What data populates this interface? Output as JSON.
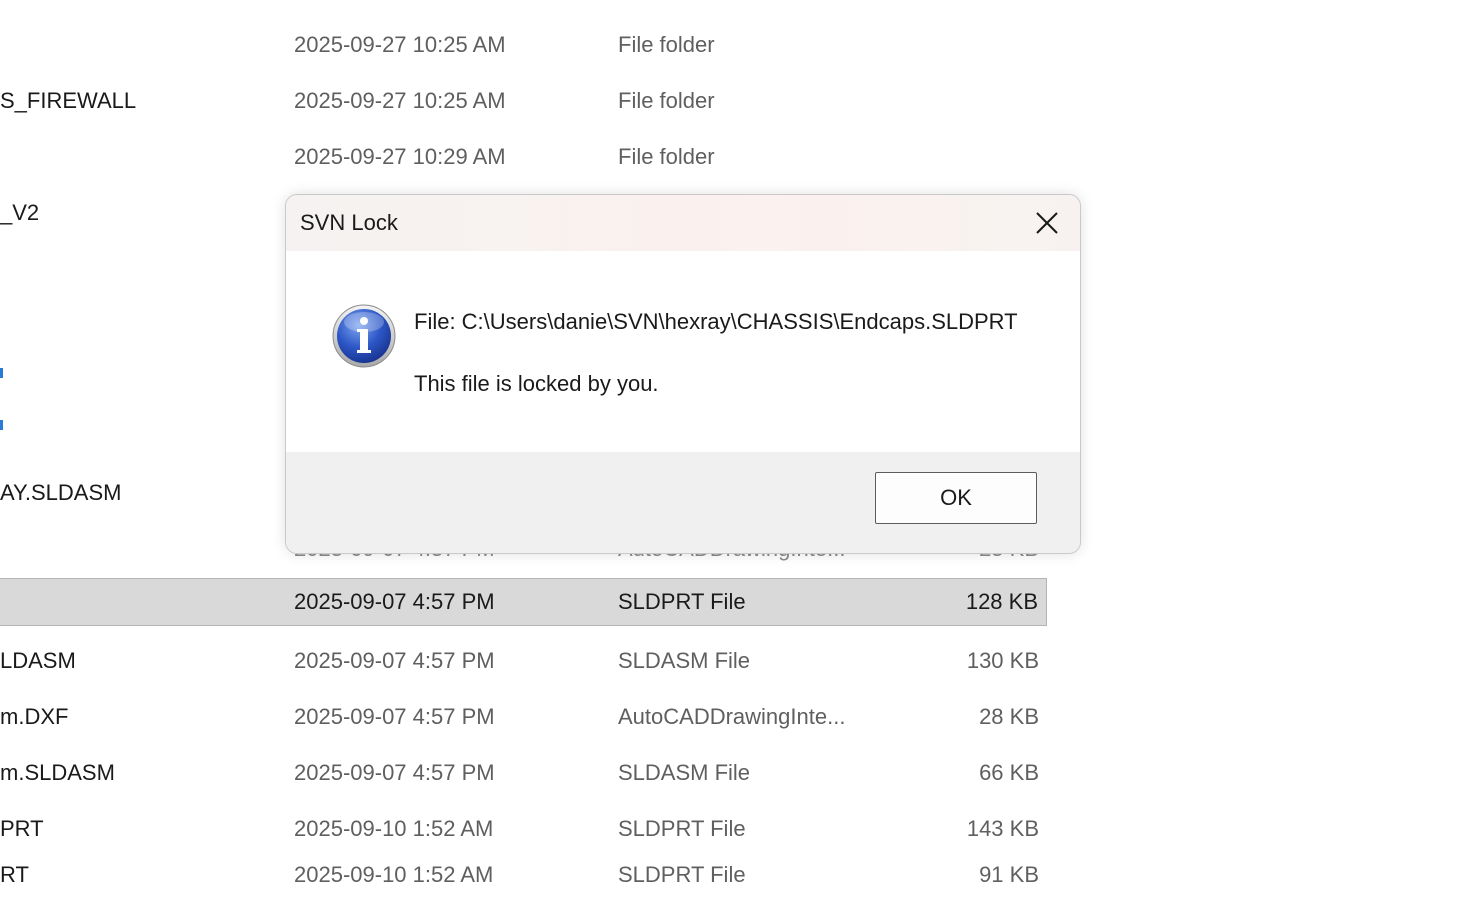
{
  "file_list": {
    "rows": [
      {
        "name": "",
        "date": "2025-09-27 10:25 AM",
        "type": "File folder",
        "size": ""
      },
      {
        "name": "S_FIREWALL",
        "date": "2025-09-27 10:25 AM",
        "type": "File folder",
        "size": ""
      },
      {
        "name": "",
        "date": "2025-09-27 10:29 AM",
        "type": "File folder",
        "size": ""
      },
      {
        "name": "_V2",
        "date": "",
        "type": "",
        "size": ""
      },
      {
        "name": "AY.SLDASM",
        "date": "",
        "type": "",
        "size": ""
      },
      {
        "name": "",
        "date": "2025-09-07 4:57 PM",
        "type": "AutoCADDrawingInte...",
        "size": "25 KB"
      },
      {
        "name": "",
        "date": "2025-09-07 4:57 PM",
        "type": "SLDPRT File",
        "size": "128 KB"
      },
      {
        "name": "LDASM",
        "date": "2025-09-07 4:57 PM",
        "type": "SLDASM File",
        "size": "130 KB"
      },
      {
        "name": "m.DXF",
        "date": "2025-09-07 4:57 PM",
        "type": "AutoCADDrawingInte...",
        "size": "28 KB"
      },
      {
        "name": "m.SLDASM",
        "date": "2025-09-07 4:57 PM",
        "type": "SLDASM File",
        "size": "66 KB"
      },
      {
        "name": "PRT",
        "date": "2025-09-10 1:52 AM",
        "type": "SLDPRT File",
        "size": "143 KB"
      },
      {
        "name": "RT",
        "date": "2025-09-10 1:52 AM",
        "type": "SLDPRT File",
        "size": "91 KB"
      }
    ]
  },
  "dialog": {
    "title": "SVN Lock",
    "icon": "info-icon",
    "message_line1": "File: C:\\Users\\danie\\SVN\\hexray\\CHASSIS\\Endcaps.SLDPRT",
    "message_line2": "This file is locked by you.",
    "ok_label": "OK",
    "close_icon": "close-icon"
  }
}
